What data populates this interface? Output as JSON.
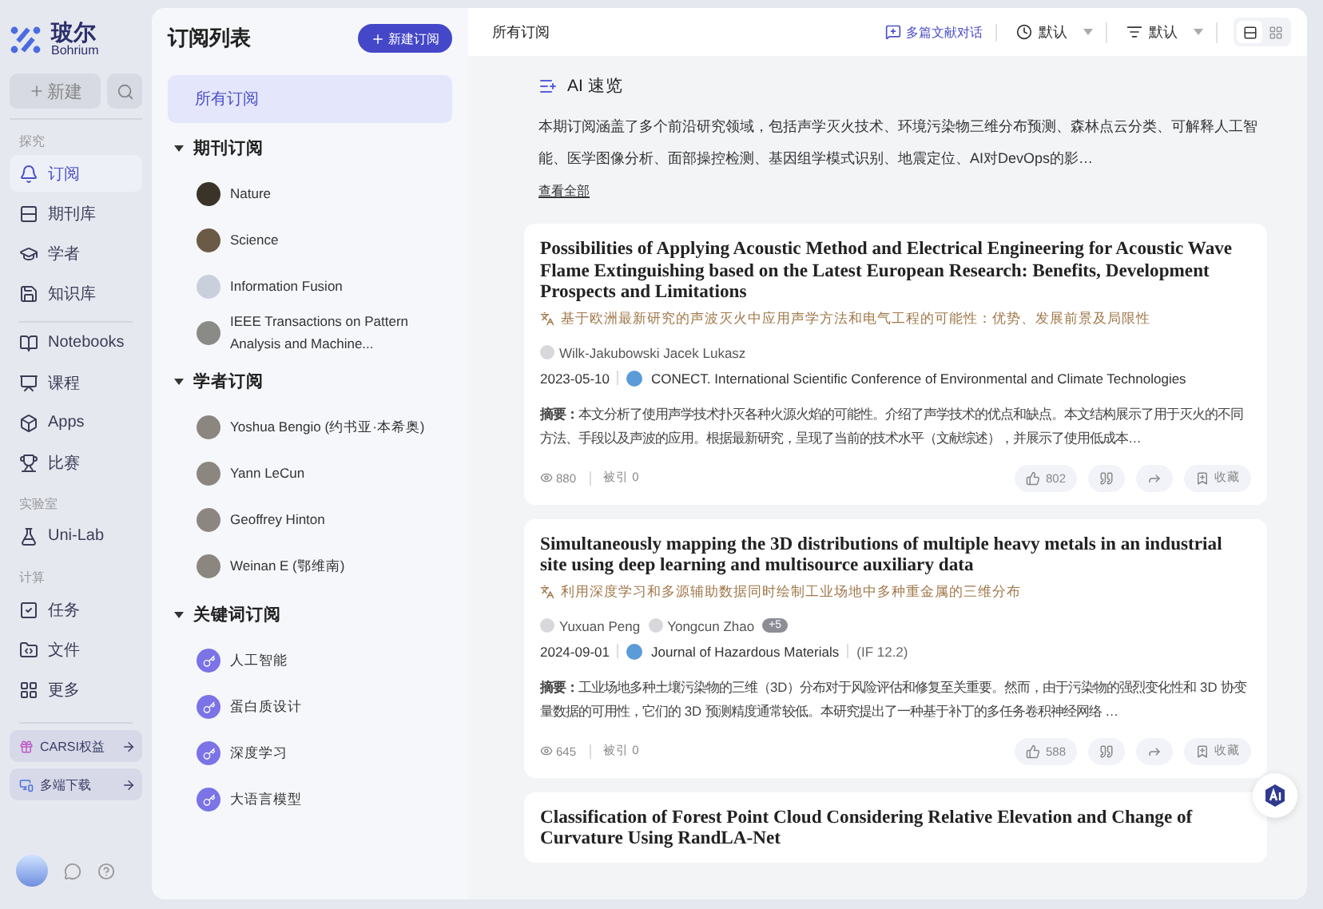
{
  "nav": {
    "brand": {
      "name": "玻尔",
      "sub": "Bohrium"
    },
    "new_button": "新建",
    "groups": [
      {
        "heading": "探究",
        "items": [
          {
            "kind": "bell",
            "label": "订阅",
            "selected": true
          },
          {
            "kind": "journals",
            "label": "期刊库",
            "selected": false
          },
          {
            "kind": "scholar",
            "label": "学者",
            "selected": false
          },
          {
            "kind": "knowledge",
            "label": "知识库",
            "selected": false
          }
        ]
      },
      {
        "items": [
          {
            "kind": "notebook",
            "label": "Notebooks",
            "selected": false
          },
          {
            "kind": "course",
            "label": "课程",
            "selected": false
          },
          {
            "kind": "apps",
            "label": "Apps",
            "selected": false
          },
          {
            "kind": "trophy",
            "label": "比赛",
            "selected": false
          }
        ]
      },
      {
        "heading": "实验室",
        "items": [
          {
            "kind": "lab",
            "label": "Uni-Lab",
            "selected": false
          }
        ]
      },
      {
        "heading": "计算",
        "items": [
          {
            "kind": "task",
            "label": "任务",
            "selected": false
          },
          {
            "kind": "files",
            "label": "文件",
            "selected": false
          },
          {
            "kind": "more",
            "label": "更多",
            "selected": false
          }
        ]
      }
    ],
    "promos": [
      {
        "kind": "gift",
        "label": "CARSI权益"
      },
      {
        "kind": "devices",
        "label": "多端下载"
      }
    ]
  },
  "subscriptions": {
    "title": "订阅列表",
    "new_button": "新建订阅",
    "all_item": {
      "label": "所有订阅",
      "selected": true
    },
    "sections": [
      {
        "title": "期刊订阅",
        "expanded": true,
        "items": [
          {
            "kind": "journal",
            "label": "Nature",
            "color": "#3a3428"
          },
          {
            "kind": "journal",
            "label": "Science",
            "color": "#6b5a45"
          },
          {
            "kind": "journal",
            "label": "Information Fusion",
            "color": "#c9d0dc"
          },
          {
            "kind": "journal",
            "label": "IEEE Transactions on Pattern Analysis and Machine...",
            "color": "#8a8a86"
          }
        ]
      },
      {
        "title": "学者订阅",
        "expanded": true,
        "items": [
          {
            "kind": "scholar",
            "label": "Yoshua Bengio (约书亚·本希奥)"
          },
          {
            "kind": "scholar",
            "label": "Yann LeCun"
          },
          {
            "kind": "scholar",
            "label": "Geoffrey Hinton"
          },
          {
            "kind": "scholar",
            "label": "Weinan E (鄂维南)"
          }
        ]
      },
      {
        "title": "关键词订阅",
        "expanded": true,
        "items": [
          {
            "kind": "keyword",
            "label": "人工智能"
          },
          {
            "kind": "keyword",
            "label": "蛋白质设计"
          },
          {
            "kind": "keyword",
            "label": "深度学习"
          },
          {
            "kind": "keyword",
            "label": "大语言模型"
          }
        ]
      }
    ]
  },
  "main": {
    "title": "所有订阅",
    "chat_button": "多篇文献对话",
    "time_sort": "默认",
    "order_sort": "默认",
    "views": [
      {
        "kind": "list",
        "selected": true
      },
      {
        "kind": "grid",
        "selected": false
      }
    ],
    "ai_summary": {
      "title": "AI 速览",
      "text": "本期订阅涵盖了多个前沿研究领域，包括声学灭火技术、环境污染物三维分布预测、森林点云分类、可解释人工智能、医学图像分析、面部操控检测、基因组学模式识别、地震定位、AI对DevOps的影…",
      "link": "查看全部"
    },
    "papers": [
      {
        "title": "Possibilities of Applying Acoustic Method and Electrical Engineering for Acoustic Wave Flame Extinguishing based on the Latest European Research: Benefits, Development Prospects and Limitations",
        "translation": "基于欧洲最新研究的声波灭火中应用声学方法和电气工程的可能性：优势、发展前景及局限性",
        "authors": [
          "Wilk-Jakubowski Jacek Lukasz"
        ],
        "date": "2023-05-10",
        "venue": "CONECT. International Scientific Conference of Environmental and Climate Technologies",
        "abstract_label": "摘要：",
        "abstract": "本文分析了使用声学技术扑灭各种火源火焰的可能性。介绍了声学技术的优点和缺点。本文结构展示了用于灭火的不同方法、手段以及声波的应用。根据最新研究，呈现了当前的技术水平（文献综述），并展示了使用低成本…",
        "views": "880",
        "citations": "被引 0",
        "likes": "802",
        "save": "收藏"
      },
      {
        "title": "Simultaneously mapping the 3D distributions of multiple heavy metals in an industrial site using deep learning and multisource auxiliary data",
        "translation": "利用深度学习和多源辅助数据同时绘制工业场地中多种重金属的三维分布",
        "authors": [
          "Yuxuan Peng",
          "Yongcun Zhao"
        ],
        "more_authors": "+5",
        "date": "2024-09-01",
        "venue": "Journal of Hazardous Materials",
        "impact": "(IF 12.2)",
        "abstract_label": "摘要：",
        "abstract": "工业场地多种土壤污染物的三维（3D）分布对于风险评估和修复至关重要。然而，由于污染物的强烈变化性和 3D 协变量数据的可用性，它们的 3D 预测精度通常较低。本研究提出了一种基于补丁的多任务卷积神经网络 …",
        "views": "645",
        "citations": "被引 0",
        "likes": "588",
        "save": "收藏"
      },
      {
        "title": "Classification of Forest Point Cloud Considering Relative Elevation and Change of Curvature Using RandLA-Net"
      }
    ]
  }
}
